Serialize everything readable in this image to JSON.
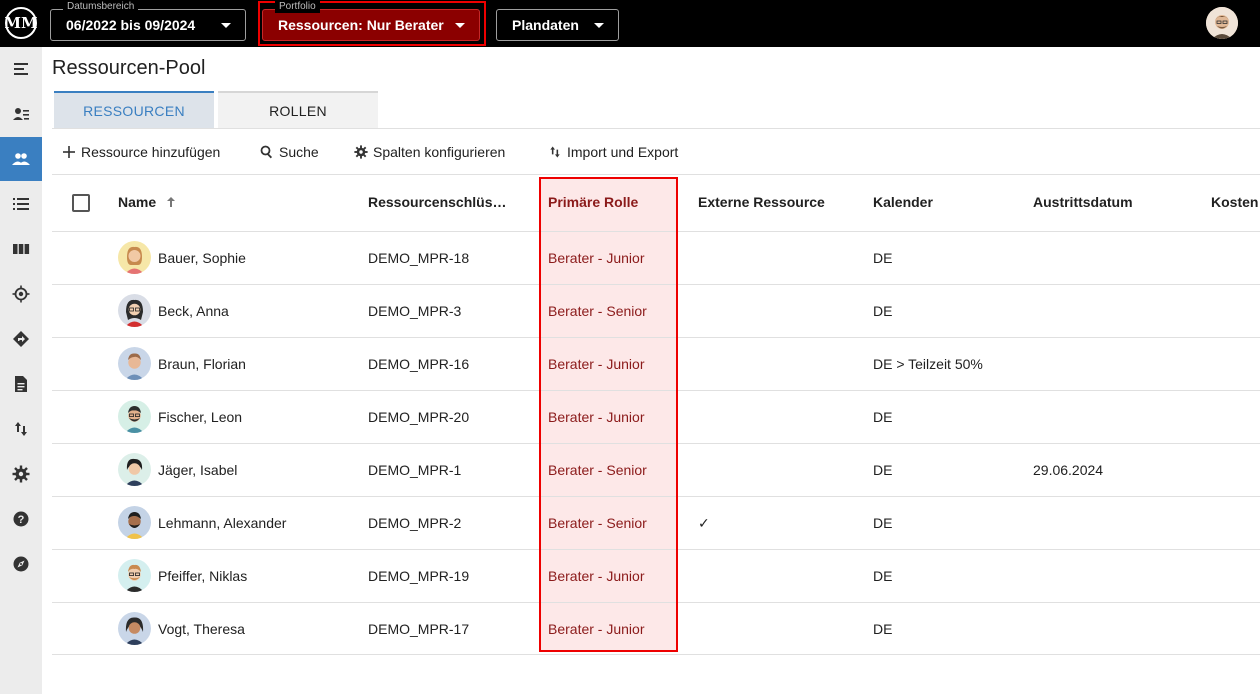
{
  "app": {
    "logo_text": "ΜΜ"
  },
  "topbar": {
    "date_range": {
      "label": "Datumsbereich",
      "value": "06/2022 bis 09/2024"
    },
    "portfolio": {
      "label": "Portfolio",
      "value": "Ressourcen: Nur Berater"
    },
    "plan": {
      "value": "Plandaten"
    }
  },
  "sidebar": {
    "items": [
      {
        "icon": "menu-collapse-icon"
      },
      {
        "icon": "person-list-icon"
      },
      {
        "icon": "people-icon",
        "active": true
      },
      {
        "icon": "list-icon"
      },
      {
        "icon": "columns-icon"
      },
      {
        "icon": "target-icon"
      },
      {
        "icon": "directions-icon"
      },
      {
        "icon": "document-icon"
      },
      {
        "icon": "import-export-icon"
      },
      {
        "icon": "gear-icon"
      },
      {
        "icon": "help-icon"
      },
      {
        "icon": "compass-icon"
      }
    ]
  },
  "page": {
    "title": "Ressourcen-Pool"
  },
  "tabs": [
    {
      "label": "RESSOURCEN",
      "active": true
    },
    {
      "label": "ROLLEN",
      "active": false
    }
  ],
  "toolbar": {
    "add": "Ressource hinzufügen",
    "search": "Suche",
    "columns": "Spalten konfigurieren",
    "import_export": "Import und Export"
  },
  "table": {
    "headers": {
      "name": "Name",
      "key": "Ressourcenschlüs…",
      "role": "Primäre Rolle",
      "external": "Externe Ressource",
      "calendar": "Kalender",
      "exit": "Austrittsdatum",
      "cost": "Kosten"
    },
    "rows": [
      {
        "name": "Bauer, Sophie",
        "key": "DEMO_MPR-18",
        "role": "Berater - Junior",
        "external": "",
        "calendar": "DE",
        "exit": ""
      },
      {
        "name": "Beck, Anna",
        "key": "DEMO_MPR-3",
        "role": "Berater - Senior",
        "external": "",
        "calendar": "DE",
        "exit": ""
      },
      {
        "name": "Braun, Florian",
        "key": "DEMO_MPR-16",
        "role": "Berater - Junior",
        "external": "",
        "calendar": "DE > Teilzeit 50%",
        "exit": ""
      },
      {
        "name": "Fischer, Leon",
        "key": "DEMO_MPR-20",
        "role": "Berater - Junior",
        "external": "",
        "calendar": "DE",
        "exit": ""
      },
      {
        "name": "Jäger, Isabel",
        "key": "DEMO_MPR-1",
        "role": "Berater - Senior",
        "external": "",
        "calendar": "DE",
        "exit": "29.06.2024"
      },
      {
        "name": "Lehmann, Alexander",
        "key": "DEMO_MPR-2",
        "role": "Berater - Senior",
        "external": "✓",
        "calendar": "DE",
        "exit": ""
      },
      {
        "name": "Pfeiffer, Niklas",
        "key": "DEMO_MPR-19",
        "role": "Berater - Junior",
        "external": "",
        "calendar": "DE",
        "exit": ""
      },
      {
        "name": "Vogt, Theresa",
        "key": "DEMO_MPR-17",
        "role": "Berater - Junior",
        "external": "",
        "calendar": "DE",
        "exit": ""
      }
    ]
  },
  "colors": {
    "accent": "#3a7fc1",
    "highlight": "#e00000",
    "role_text": "#8b1a1a",
    "role_bg": "#fde8e8"
  }
}
